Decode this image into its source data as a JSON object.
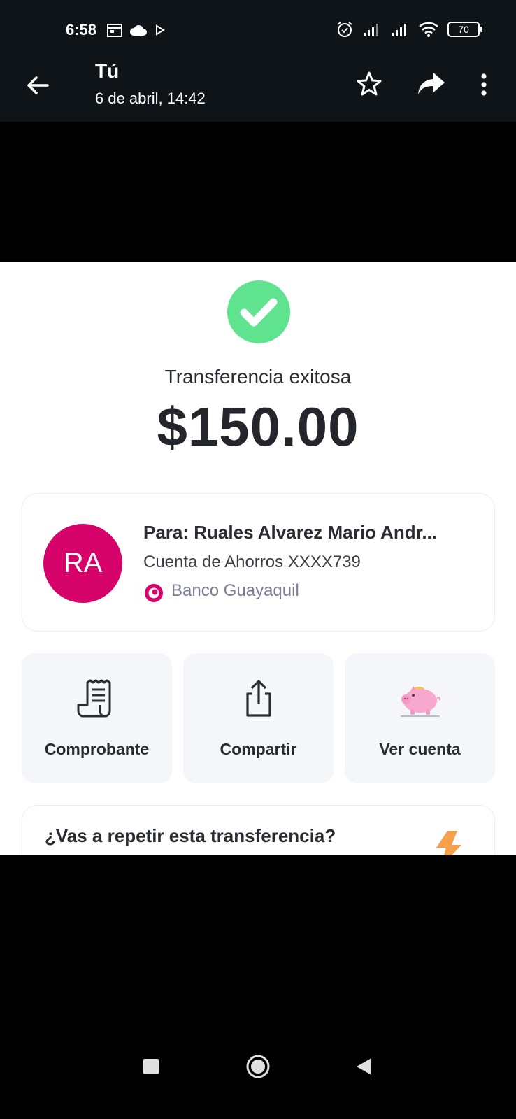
{
  "status_bar": {
    "time": "6:58",
    "battery": "70",
    "icons": [
      "calendar-icon",
      "cloud-icon",
      "play-icon",
      "alarm-icon",
      "signal-icon",
      "signal-icon",
      "wifi-icon",
      "battery-icon"
    ]
  },
  "app_bar": {
    "title": "Tú",
    "subtitle": "6 de abril, 14:42",
    "icons": [
      "back-arrow-icon",
      "star-icon",
      "share-icon",
      "more-vert-icon"
    ]
  },
  "receipt": {
    "status": "Transferencia exitosa",
    "amount": "$150.00",
    "recipient": {
      "initials": "RA",
      "to": "Para: Ruales Alvarez Mario Andr...",
      "account": "Cuenta de Ahorros XXXX739",
      "bank": "Banco Guayaquil"
    },
    "actions": [
      {
        "label": "Comprobante",
        "icon": "receipt-icon"
      },
      {
        "label": "Compartir",
        "icon": "share-upload-icon"
      },
      {
        "label": "Ver cuenta",
        "icon": "piggy-bank-icon"
      }
    ],
    "repeat_prompt": "¿Vas a repetir esta transferencia?"
  },
  "colors": {
    "success": "#5fe38f",
    "avatar": "#d6036a",
    "bolt": "#f5a04a",
    "bar": "#0f1419"
  }
}
